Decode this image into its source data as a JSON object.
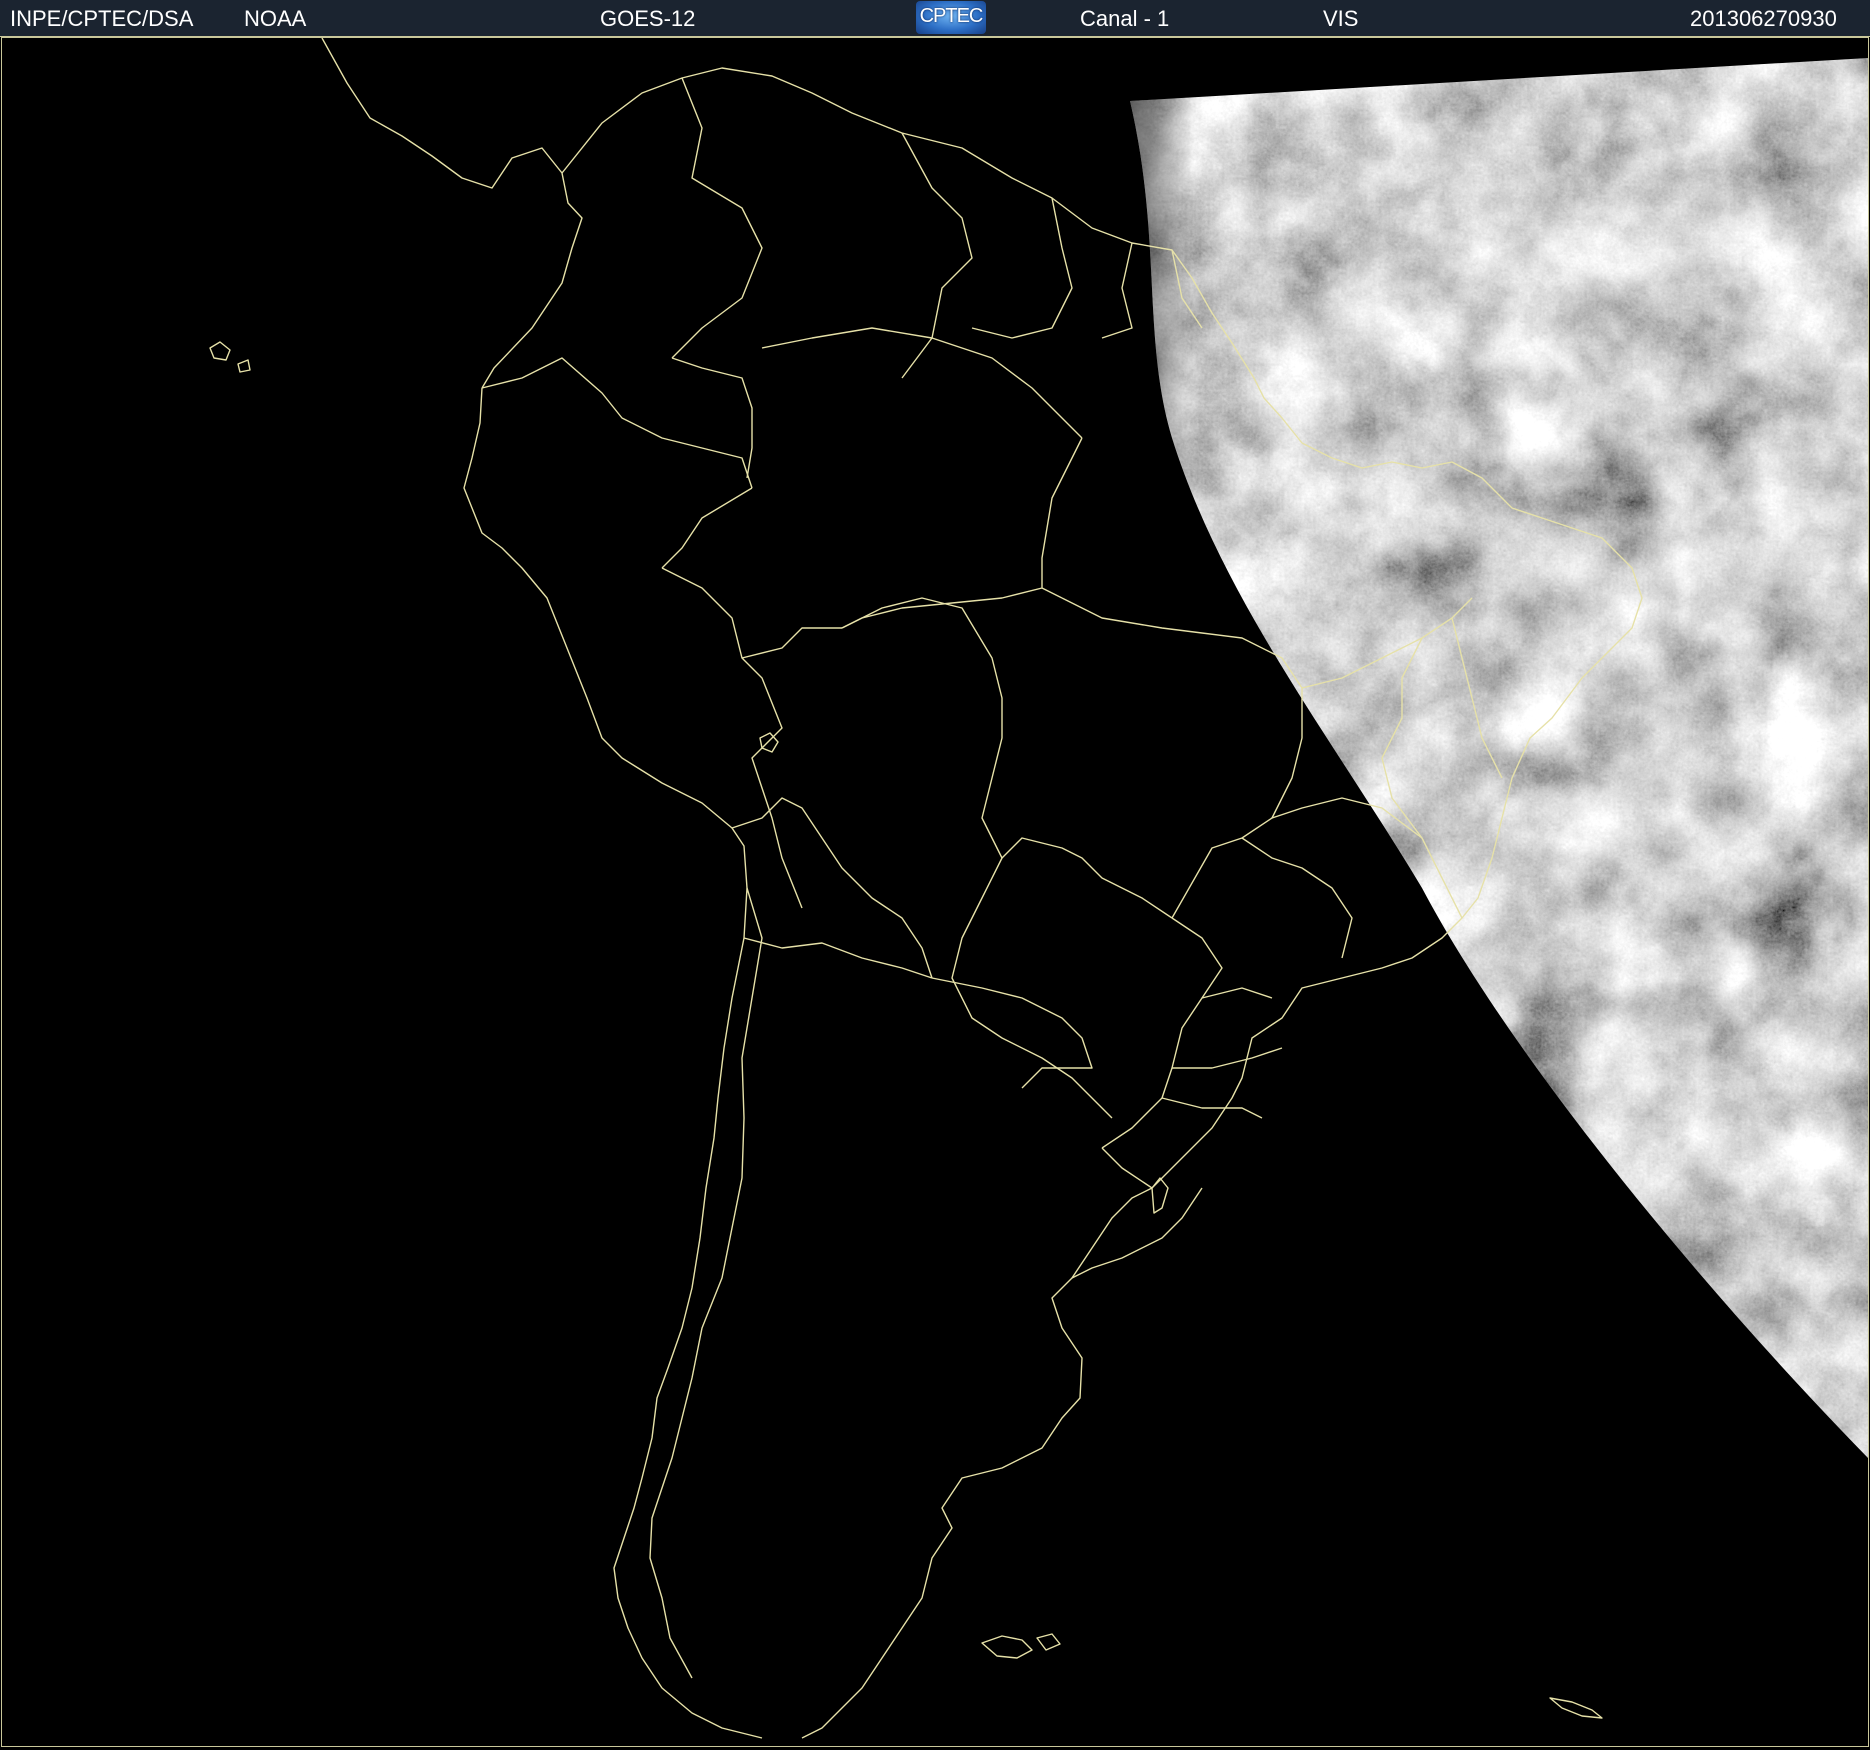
{
  "header": {
    "institution": "INPE/CPTEC/DSA",
    "agency": "NOAA",
    "satellite": "GOES-12",
    "logo_text": "CPTEC",
    "channel": "Canal - 1",
    "band": "VIS",
    "timestamp": "201306270930"
  },
  "colors": {
    "header_background": "#1b2430",
    "border_lines": "#c9c79a",
    "background": "#000000",
    "cloud_field": "#8c8c8c"
  }
}
